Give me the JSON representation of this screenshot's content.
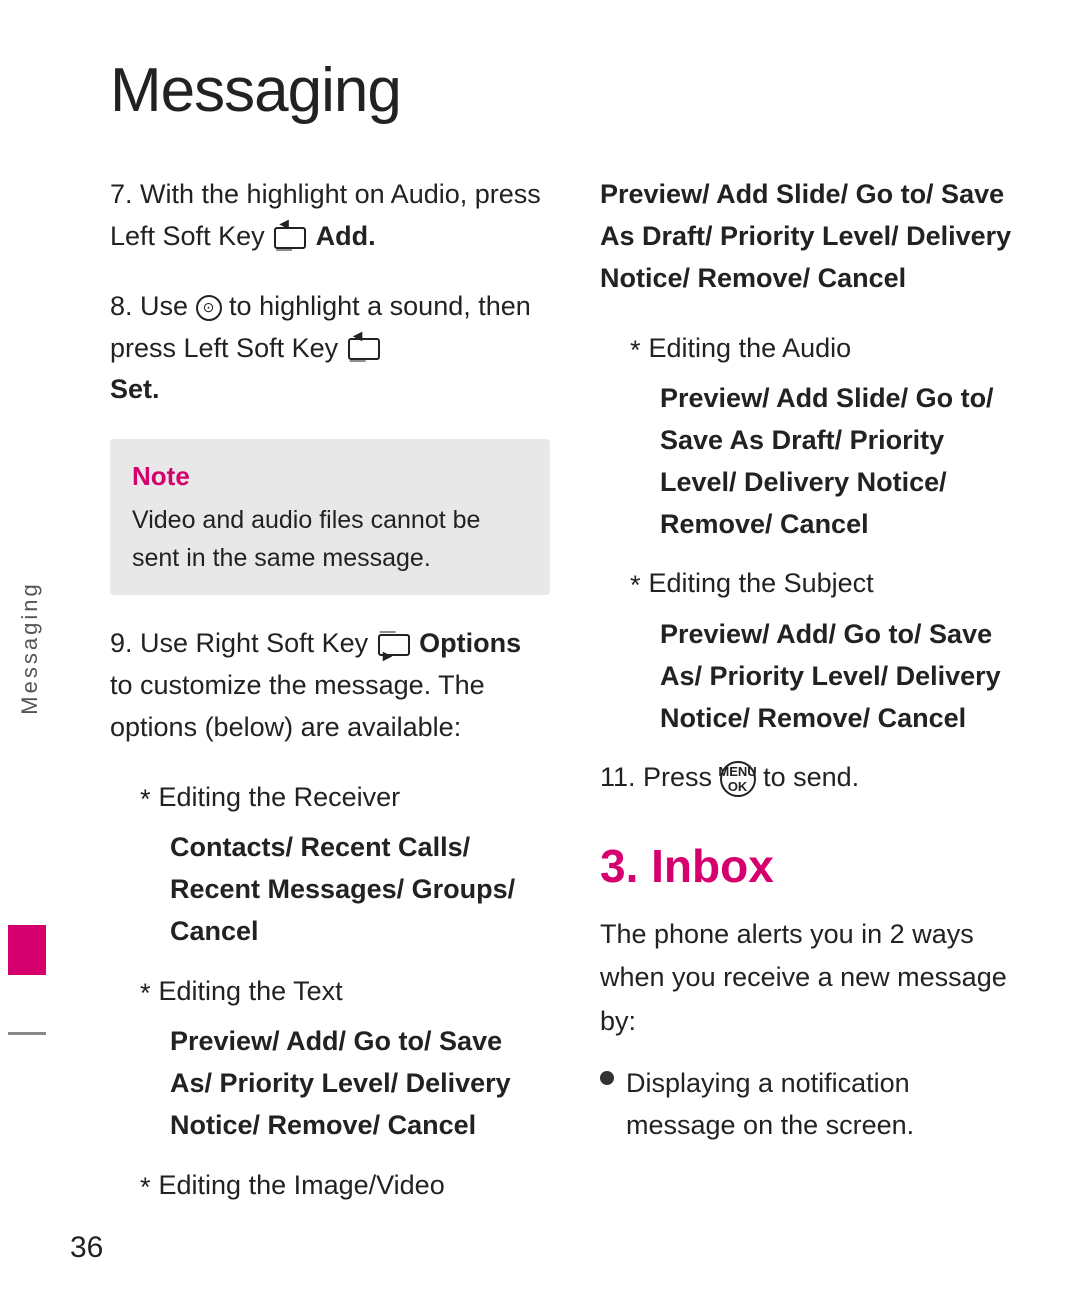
{
  "page": {
    "title": "Messaging",
    "page_number": "36",
    "sidebar_label": "Messaging"
  },
  "left_col": {
    "item7": {
      "text_before": "7.  With the highlight on Audio, press Left Soft Key ",
      "icon_label": "◄—",
      "bold_text": "Add."
    },
    "item8": {
      "text_before": "8. Use ",
      "icon_label": "⊙",
      "text_after": " to highlight a sound, then press Left Soft Key ",
      "icon2_label": "◄—",
      "bold_text": "Set."
    },
    "note": {
      "label": "Note",
      "text": "Video and audio files cannot be sent in the same message."
    },
    "item9": {
      "text_before": "9. Use Right Soft Key ",
      "icon_label": "—►",
      "bold_part": "Options",
      "text_after": " to customize the message. The options (below) are available:"
    },
    "sub_receiver": {
      "label": "Editing the Receiver",
      "options": "Contacts/ Recent Calls/ Recent Messages/ Groups/ Cancel"
    },
    "sub_text": {
      "label": "Editing the Text",
      "options": "Preview/ Add/ Go to/ Save As/ Priority Level/ Delivery Notice/ Remove/ Cancel"
    },
    "sub_image": {
      "label": "Editing the Image/Video"
    }
  },
  "right_col": {
    "image_video_options": "Preview/ Add Slide/ Go to/ Save As Draft/ Priority Level/ Delivery Notice/ Remove/ Cancel",
    "sub_audio": {
      "label": "Editing the Audio",
      "options": "Preview/ Add Slide/ Go to/ Save As Draft/ Priority Level/ Delivery Notice/ Remove/ Cancel"
    },
    "sub_subject": {
      "label": "Editing the Subject",
      "options": "Preview/ Add/ Go to/ Save As/ Priority Level/ Delivery Notice/ Remove/ Cancel"
    },
    "item11": {
      "text_before": "11. Press ",
      "icon_label": "MENU\nOK",
      "text_after": " to send."
    },
    "section3": {
      "heading": "3. Inbox",
      "para": "The phone alerts you in 2  ways when you receive a new message by:",
      "bullets": [
        "Displaying a notification message on the screen."
      ]
    }
  }
}
